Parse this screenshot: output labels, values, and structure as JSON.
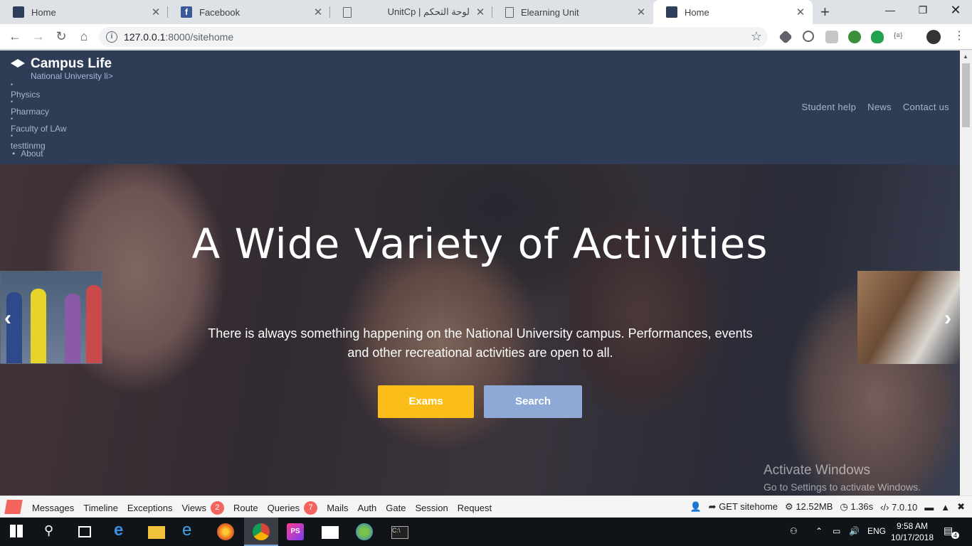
{
  "browser": {
    "tabs": [
      {
        "title": "Home",
        "favicon": "campus-favicon"
      },
      {
        "title": "Facebook",
        "favicon": "facebook-favicon"
      },
      {
        "title": "UnitCp | لوحة التحكم",
        "favicon": "document-favicon"
      },
      {
        "title": "Elearning Unit",
        "favicon": "document-favicon"
      },
      {
        "title": "Home",
        "favicon": "campus-favicon",
        "active": true
      }
    ],
    "url_host": "127.0.0.1",
    "url_rest": ":8000/sitehome"
  },
  "site": {
    "brand": "Campus Life",
    "subbrand": "National University  li>",
    "menu": [
      "Physics",
      "Pharmacy",
      "Faculty of LAw",
      "testtinmg"
    ],
    "about": "About",
    "nav": [
      "Student help",
      "News",
      "Contact us"
    ],
    "hero": {
      "title": "A Wide Variety of Activities",
      "text": "There is always something happening on the National University campus. Performances, events and other recreational activities are open to all.",
      "buttons": {
        "exams": "Exams",
        "search": "Search"
      }
    },
    "watermark": {
      "line1": "Activate Windows",
      "line2": "Go to Settings to activate Windows."
    }
  },
  "debugbar": {
    "items": [
      "Messages",
      "Timeline",
      "Exceptions",
      "Views",
      "Route",
      "Queries",
      "Mails",
      "Auth",
      "Gate",
      "Session",
      "Request"
    ],
    "views_count": "2",
    "queries_count": "7",
    "request": "GET sitehome",
    "memory": "12.52MB",
    "time": "1.36s",
    "php": "7.0.10"
  },
  "taskbar": {
    "language": "ENG",
    "time": "9:58 AM",
    "date": "10/17/2018",
    "notifications": "4"
  },
  "colors": {
    "header_bg": "#2e3c56",
    "exams_btn": "#fbbd1a",
    "search_btn": "#8fa9d6",
    "debug_badge": "#f4645f"
  }
}
